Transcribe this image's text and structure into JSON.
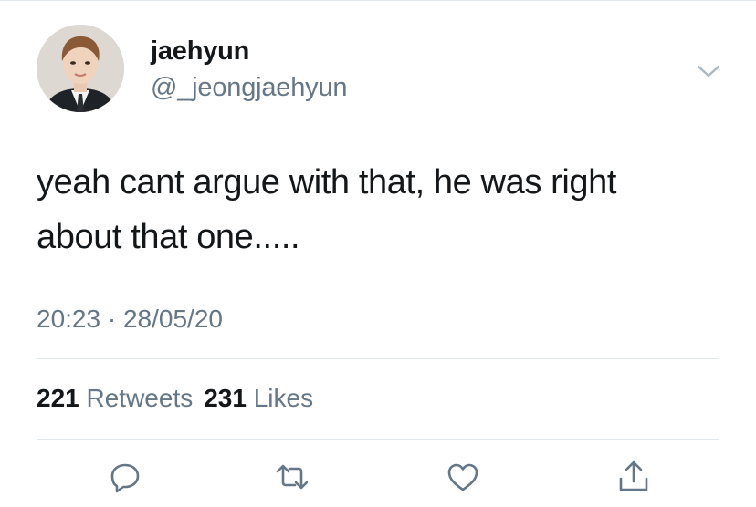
{
  "tweet": {
    "author": {
      "display_name": "jaehyun",
      "handle": "@_jeongjaehyun",
      "avatar": "profile-photo"
    },
    "text_line_1": "yeah cant argue with that, he was right",
    "text_line_2": "about that one.....",
    "time": "20:23",
    "separator": "·",
    "date": "28/05/20",
    "stats": {
      "retweets_count": "221",
      "retweets_label": "Retweets",
      "likes_count": "231",
      "likes_label": "Likes"
    },
    "actions": [
      "reply-icon",
      "retweet-icon",
      "like-icon",
      "share-icon"
    ]
  },
  "colors": {
    "text_primary": "#14171a",
    "text_secondary": "#657786",
    "divider": "#e1e8ed",
    "icon": "#657786"
  }
}
